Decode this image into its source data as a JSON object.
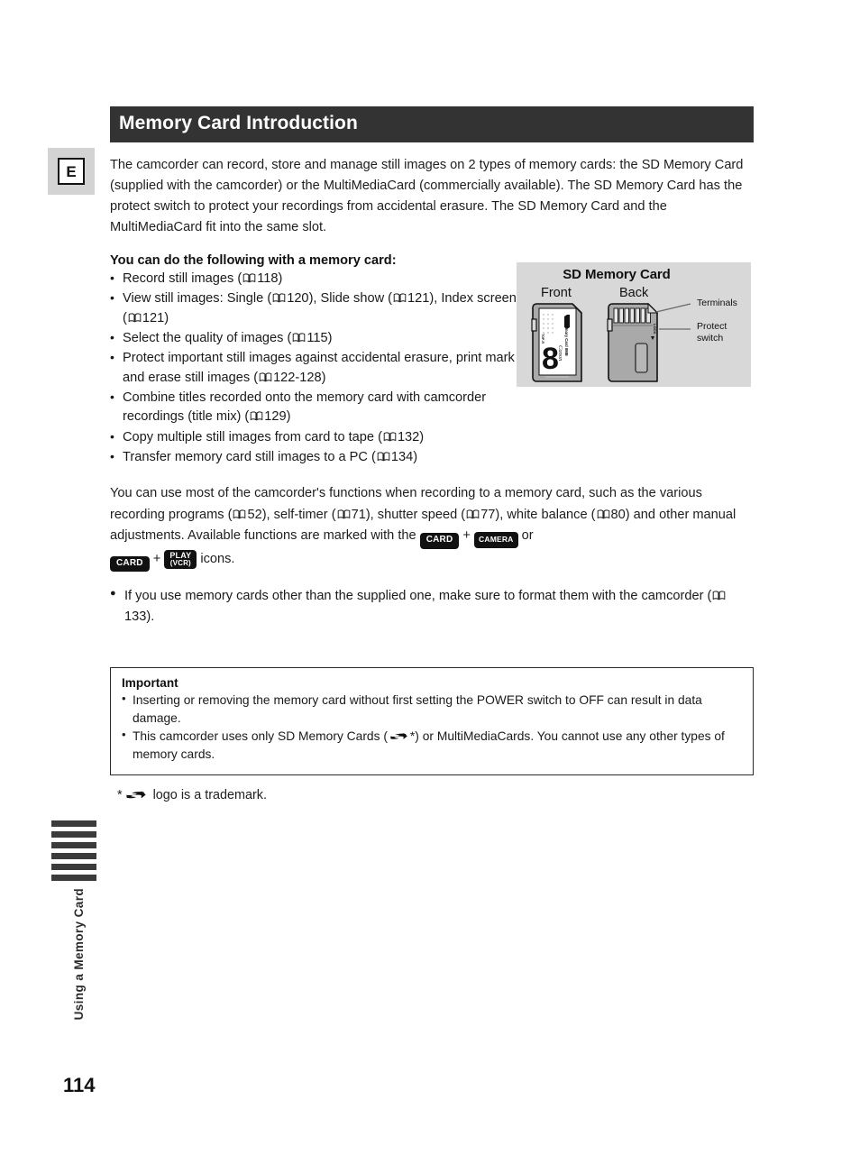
{
  "page": {
    "number": "114",
    "language_tab": "E",
    "side_index_label": "Using a Memory Card",
    "side_index_bar_count": 6
  },
  "header": {
    "title": "Memory Card Introduction"
  },
  "intro": {
    "paragraph": "The camcorder can record, store and manage still images on 2 types of memory cards: the SD Memory Card (supplied with the camcorder) or the MultiMediaCard (commercially available). The SD Memory Card has the protect switch to protect your recordings from accidental erasure. The SD Memory Card and the MultiMediaCard fit into the same slot."
  },
  "capabilities": {
    "heading": "You can do the following with a memory card:",
    "items": [
      {
        "text_before": "Record still images (",
        "refs": [
          {
            "page": "118"
          }
        ],
        "text_after": ")"
      },
      {
        "text_before": "View still images: Single (",
        "refs": [
          {
            "page": "120"
          },
          {
            "page": "121"
          },
          {
            "page": "121"
          }
        ],
        "text_mid1": "), Slide show (",
        "text_mid2": "), Index screen (",
        "text_after": ")"
      },
      {
        "text_before": "Select the quality of images (",
        "refs": [
          {
            "page": "115"
          }
        ],
        "text_after": ")"
      },
      {
        "text_before": "Protect important still images against accidental erasure, print mark and erase still images (",
        "refs": [
          {
            "page": "122-128"
          }
        ],
        "text_after": ")"
      },
      {
        "text_before": "Combine titles recorded onto the memory card with camcorder recordings (title mix) (",
        "refs": [
          {
            "page": "129"
          }
        ],
        "text_after": ")"
      },
      {
        "text_before": "Copy multiple still images from card to tape (",
        "refs": [
          {
            "page": "132"
          }
        ],
        "text_after": ")"
      },
      {
        "text_before": "Transfer memory card still images to a PC (",
        "refs": [
          {
            "page": "134"
          }
        ],
        "text_after": ")"
      }
    ]
  },
  "figure": {
    "title": "SD Memory Card",
    "front_label": "Front",
    "back_label": "Back",
    "terminals_label": "Terminals",
    "protect_label_line1": "Protect",
    "protect_label_line2": "switch",
    "card_face_text": {
      "brand": "Canon",
      "capacity": "8",
      "product": "SD Memory Card 8MB",
      "logo": "SD"
    },
    "back_lock_text": "LOCK",
    "background_color": "#d8d8d8"
  },
  "functions_paragraph": {
    "seg1": "You can use most of the camcorder's functions when recording to a memory card, such as the various recording programs (",
    "ref1": "52",
    "seg2": "), self-timer (",
    "ref2": "71",
    "seg3": "), shutter speed (",
    "ref3": "77",
    "seg4": "), white balance (",
    "ref4": "80",
    "seg5": ") and other manual adjustments. Available functions are marked with the ",
    "chip_card": "CARD",
    "plus": "+",
    "chip_camera": "CAMERA",
    "seg6": " or ",
    "chip_play_line1": "PLAY",
    "chip_play_line2": "(VCR)",
    "seg7": " icons."
  },
  "format_note": {
    "seg1": "If you use memory cards other than the supplied one, make sure to format them with the camcorder (",
    "ref": "133",
    "seg2": ")."
  },
  "important": {
    "title": "Important",
    "items": [
      {
        "seg1": "Inserting or removing the memory card without first setting the POWER switch to OFF can result in data damage.",
        "seg2": ""
      },
      {
        "seg1": "This camcorder uses only SD Memory Cards (",
        "seg2": "*) or MultiMediaCards. You cannot use any other types of memory cards."
      }
    ]
  },
  "footnote": {
    "marker": "*",
    "text": " logo is a trademark."
  },
  "colors": {
    "header_bar": "#333333",
    "figure_bg": "#d8d8d8",
    "tab_bg": "#d3d3d3",
    "text": "#1e1e1e"
  }
}
